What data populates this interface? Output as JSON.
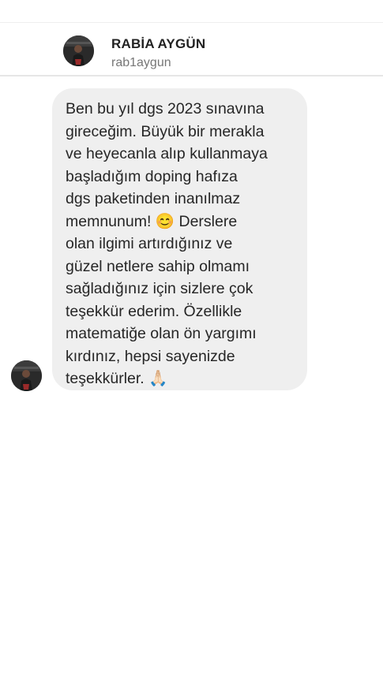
{
  "header": {
    "display_name": "RABİA AYGÜN",
    "username": "rab1aygun",
    "avatar_icon": "profile-photo-avatar"
  },
  "thread": {
    "messages": [
      {
        "sender": "incoming",
        "text": "Ben bu yıl dgs 2023 sınavına\ngireceğim. Büyük bir merakla\nve heyecanla alıp kullanmaya\nbaşladığım doping hafıza\ndgs paketinden inanılmaz\nmemnunum! 😊  Derslere\nolan ilgimi artırdığınız ve\ngüzel netlere sahip olmamı\nsağladığınız için sizlere çok\nteşekkür ederim. Özellikle\nmatematiğe olan ön yargımı\nkırdınız, hepsi sayenizde\nteşekkürler. 🙏🏻"
      }
    ]
  },
  "colors": {
    "bubble_background": "#efefef",
    "name_text": "#222222",
    "username_text": "#777777",
    "message_text": "#262626"
  }
}
